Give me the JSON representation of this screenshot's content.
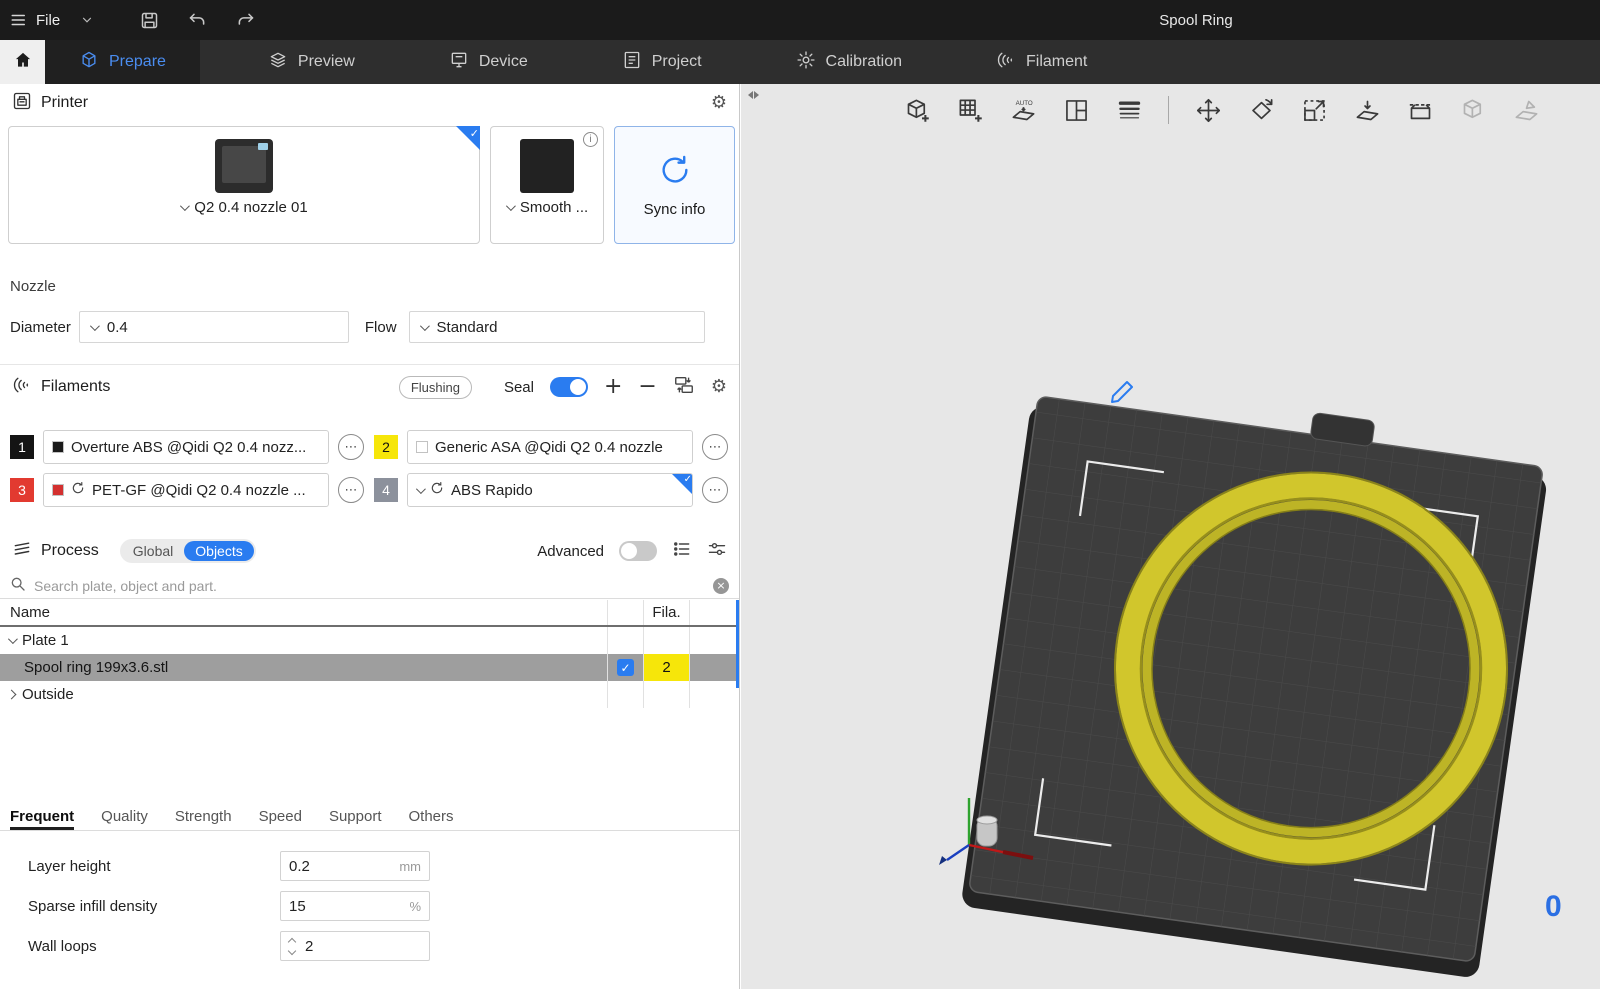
{
  "titlebar": {
    "file_label": "File",
    "document_title": "Spool Ring",
    "icons": [
      "menu-icon",
      "chevron-down-icon",
      "save-icon",
      "undo-icon",
      "redo-icon"
    ]
  },
  "tabs": [
    {
      "label": "Prepare",
      "active": true
    },
    {
      "label": "Preview",
      "active": false
    },
    {
      "label": "Device",
      "active": false
    },
    {
      "label": "Project",
      "active": false
    },
    {
      "label": "Calibration",
      "active": false
    },
    {
      "label": "Filament",
      "active": false
    }
  ],
  "printer_panel": {
    "title": "Printer",
    "printer_name": "Q2 0.4 nozzle 01",
    "plate_type": "Smooth ...",
    "sync_label": "Sync info",
    "nozzle_label": "Nozzle",
    "diameter_label": "Diameter",
    "diameter_value": "0.4",
    "flow_label": "Flow",
    "flow_value": "Standard"
  },
  "filaments_panel": {
    "title": "Filaments",
    "flushing_label": "Flushing",
    "seal_label": "Seal",
    "seal_on": true,
    "slots": [
      {
        "index": "1",
        "badge_bg": "#141414",
        "badge_fg": "#ffffff",
        "swatch": "#1a1a1a",
        "name": "Overture ABS @Qidi Q2 0.4 nozz..."
      },
      {
        "index": "2",
        "badge_bg": "#f6e60a",
        "badge_fg": "#111111",
        "swatch": "#ffffff",
        "name": "Generic ASA @Qidi Q2 0.4 nozzle"
      },
      {
        "index": "3",
        "badge_bg": "#e23a30",
        "badge_fg": "#ffffff",
        "swatch": "#d3302f",
        "name": "PET-GF @Qidi Q2 0.4 nozzle ..."
      },
      {
        "index": "4",
        "badge_bg": "#8c919c",
        "badge_fg": "#ffffff",
        "swatch": "",
        "name": "ABS Rapido",
        "selected": true
      }
    ]
  },
  "process_panel": {
    "title": "Process",
    "global_label": "Global",
    "objects_label": "Objects",
    "selected_scope": "Objects",
    "advanced_label": "Advanced",
    "advanced_on": false,
    "search_placeholder": "Search plate, object and part.",
    "table": {
      "name_header": "Name",
      "fila_header": "Fila."
    },
    "rows": [
      {
        "label": "Plate 1",
        "expanded": true
      },
      {
        "label": "Spool ring 199x3.6.stl",
        "selected": true,
        "checked": true,
        "filament": "2",
        "filament_color": "#f6e60a"
      },
      {
        "label": "Outside",
        "expanded": false
      }
    ]
  },
  "param_tabs": [
    {
      "label": "Frequent",
      "active": true
    },
    {
      "label": "Quality",
      "active": false
    },
    {
      "label": "Strength",
      "active": false
    },
    {
      "label": "Speed",
      "active": false
    },
    {
      "label": "Support",
      "active": false
    },
    {
      "label": "Others",
      "active": false
    }
  ],
  "params": [
    {
      "label": "Layer height",
      "value": "0.2",
      "unit": "mm"
    },
    {
      "label": "Sparse infill density",
      "value": "15",
      "unit": "%"
    },
    {
      "label": "Wall loops",
      "value": "2",
      "unit": ""
    }
  ],
  "viewport": {
    "plate_number": "0",
    "toolbar_icons": [
      "add-object-icon",
      "add-plate-icon",
      "auto-orient-icon",
      "arrange-icon",
      "variable-layer-height-icon",
      "move-icon",
      "rotate-icon",
      "scale-icon",
      "place-on-face-icon",
      "cut-icon",
      "support-paint-icon",
      "seam-paint-icon"
    ],
    "object_name": "spool ring"
  },
  "colors": {
    "accent": "#2a7cf0",
    "filament_yellow": "#f6e60a",
    "selected_row": "#9e9e9e",
    "ring_yellow": "#d1c62c",
    "plate_gray": "#3d3d3d",
    "viewport_bg": "#e7e7e7"
  }
}
